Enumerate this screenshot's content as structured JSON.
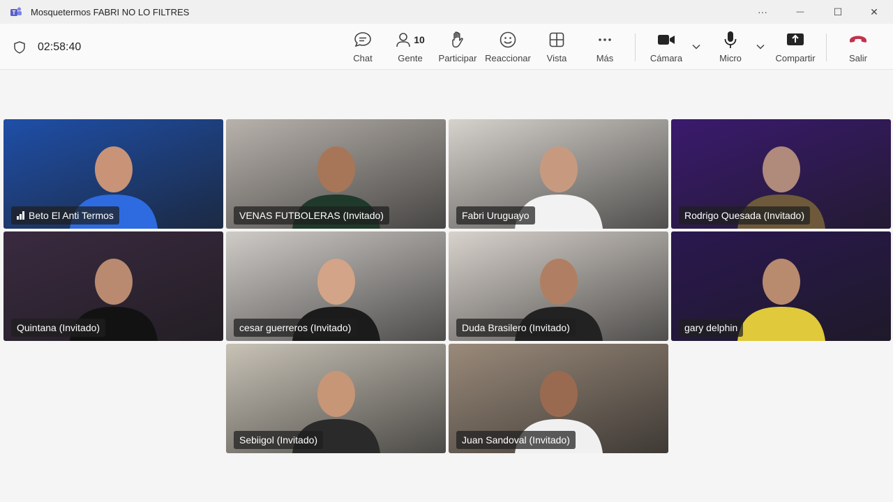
{
  "window": {
    "title": "Mosquetermos FABRI NO LO FILTRES",
    "more_glyph": "···",
    "minimize_glyph": "—",
    "maximize_glyph": "☐",
    "close_glyph": "✕"
  },
  "meeting": {
    "timer": "02:58:40"
  },
  "toolbar": {
    "chat": "Chat",
    "people": "Gente",
    "people_count": "10",
    "raise": "Participar",
    "react": "Reaccionar",
    "view": "Vista",
    "more": "Más",
    "camera": "Cámara",
    "mic": "Micro",
    "share": "Compartir",
    "leave": "Salir"
  },
  "participants": [
    {
      "name": "Beto El Anti Termos",
      "bg": "#1f4fa8",
      "shirt": "#2e6be0",
      "skin": "#c99377",
      "signal": true
    },
    {
      "name": "VENAS FUTBOLERAS (Invitado)",
      "bg": "#b8b2ac",
      "shirt": "#1f3a2a",
      "skin": "#a77658"
    },
    {
      "name": "Fabri Uruguayo",
      "bg": "#d6d2cc",
      "shirt": "#f2f2f2",
      "skin": "#c79a80"
    },
    {
      "name": "Rodrigo Quesada (Invitado)",
      "bg": "#3a1a6e",
      "shirt": "#6e5a3a",
      "skin": "#b08a7a"
    },
    {
      "name": "Quintana (Invitado)",
      "bg": "#3a2a40",
      "shirt": "#121212",
      "skin": "#b98a70"
    },
    {
      "name": "cesar guerreros (Invitado)",
      "bg": "#cfcbc7",
      "shirt": "#1b1b1b",
      "skin": "#d3a487"
    },
    {
      "name": "Duda Brasilero (Invitado)",
      "bg": "#d8d2cc",
      "shirt": "#222222",
      "skin": "#b07f63"
    },
    {
      "name": "gary delphin",
      "bg": "#2a1850",
      "shirt": "#e0c93a",
      "skin": "#b88a6e",
      "active": true
    },
    {
      "name": "Sebiigol (Invitado)",
      "bg": "#c8c2b6",
      "shirt": "#2a2a2a",
      "skin": "#c79677"
    },
    {
      "name": "Juan Sandoval (Invitado)",
      "bg": "#9a8a7a",
      "shirt": "#f0f0f0",
      "skin": "#9a6a50"
    }
  ],
  "colors": {
    "accent": "#7f85f5",
    "leave_red": "#c4314b",
    "teams_purple": "#5b5fc7"
  }
}
